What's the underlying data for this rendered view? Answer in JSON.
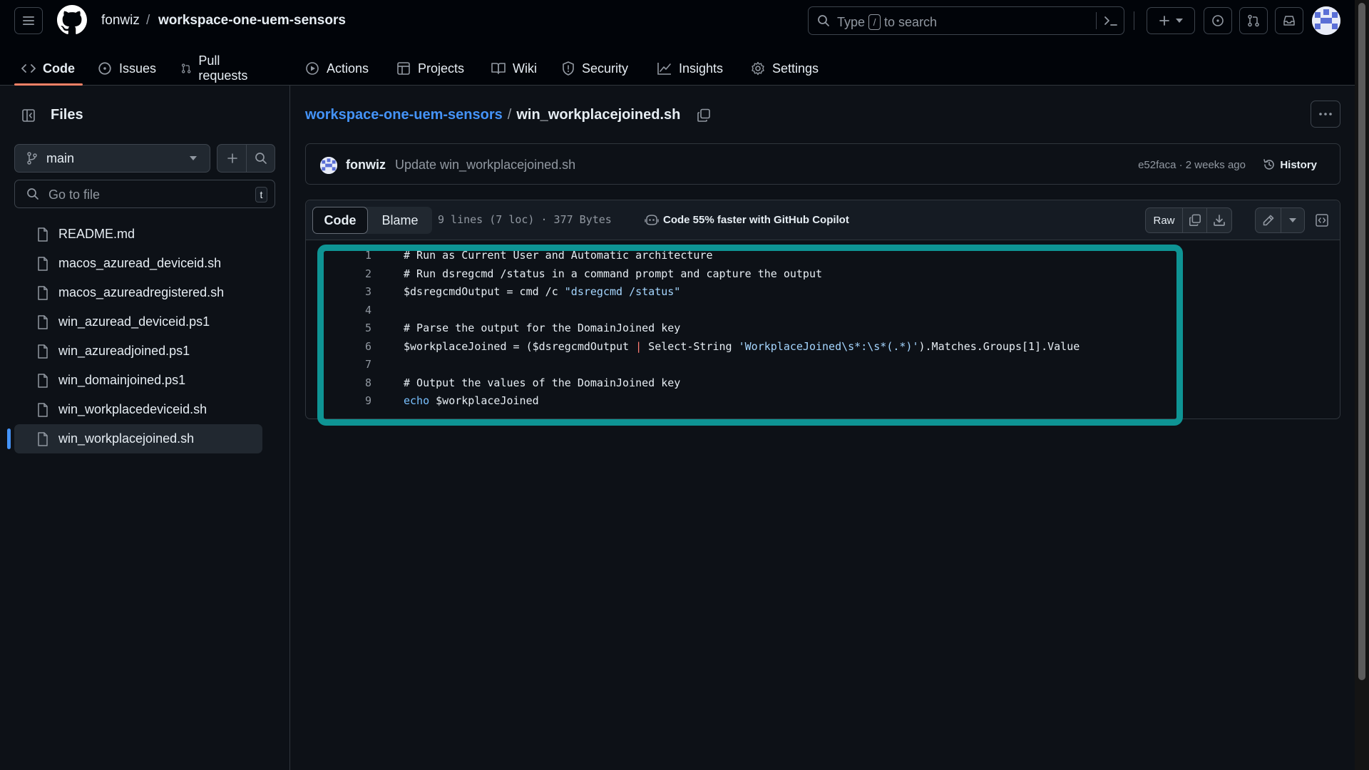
{
  "header": {
    "owner": "fonwiz",
    "separator": "/",
    "repo": "workspace-one-uem-sensors",
    "search": {
      "prefix": "Type",
      "key": "/",
      "suffix": "to search"
    },
    "icons": [
      "menu-icon",
      "github-logo",
      "search-icon",
      "terminal-icon",
      "plus-icon",
      "issues-icon",
      "pull-request-icon",
      "inbox-icon"
    ]
  },
  "nav": {
    "tabs": [
      {
        "label": "Code",
        "icon": "code-icon",
        "active": true
      },
      {
        "label": "Issues",
        "icon": "issues-icon"
      },
      {
        "label": "Pull requests",
        "icon": "pull-request-icon"
      },
      {
        "label": "Actions",
        "icon": "play-icon"
      },
      {
        "label": "Projects",
        "icon": "table-icon"
      },
      {
        "label": "Wiki",
        "icon": "book-icon"
      },
      {
        "label": "Security",
        "icon": "shield-icon"
      },
      {
        "label": "Insights",
        "icon": "graph-icon"
      },
      {
        "label": "Settings",
        "icon": "gear-icon"
      }
    ]
  },
  "sidebar": {
    "title": "Files",
    "branch": "main",
    "goto_placeholder": "Go to file",
    "goto_key": "t",
    "files": [
      {
        "name": "README.md"
      },
      {
        "name": "macos_azuread_deviceid.sh"
      },
      {
        "name": "macos_azureadregistered.sh"
      },
      {
        "name": "win_azuread_deviceid.ps1"
      },
      {
        "name": "win_azureadjoined.ps1"
      },
      {
        "name": "win_domainjoined.ps1"
      },
      {
        "name": "win_workplacedeviceid.sh"
      },
      {
        "name": "win_workplacejoined.sh",
        "selected": true
      }
    ]
  },
  "main": {
    "path": {
      "repo": "workspace-one-uem-sensors",
      "separator": "/",
      "file": "win_workplacejoined.sh"
    },
    "commit": {
      "author": "fonwiz",
      "message": "Update win_workplacejoined.sh",
      "meta": "e52faca · 2 weeks ago",
      "history_label": "History"
    },
    "toolbar": {
      "code_tab": "Code",
      "blame_tab": "Blame",
      "file_info": "9 lines (7 loc) · 377 Bytes",
      "copilot": "Code 55% faster with GitHub Copilot",
      "raw_label": "Raw"
    },
    "code_lines": [
      {
        "n": "1",
        "text": "# Run as Current User and Automatic architecture"
      },
      {
        "n": "2",
        "text": "# Run dsregcmd /status in a command prompt and capture the output"
      },
      {
        "n": "3",
        "text": "$dsregcmdOutput = cmd /c \"dsregcmd /status\""
      },
      {
        "n": "4",
        "text": ""
      },
      {
        "n": "5",
        "text": "# Parse the output for the DomainJoined key"
      },
      {
        "n": "6",
        "text": "$workplaceJoined = ($dsregcmdOutput | Select-String 'WorkplaceJoined\\s*:\\s*(.*)').Matches.Groups[1].Value"
      },
      {
        "n": "7",
        "text": ""
      },
      {
        "n": "8",
        "text": "# Output the values of the DomainJoined key"
      },
      {
        "n": "9",
        "text": "echo $workplaceJoined"
      }
    ]
  },
  "colors": {
    "accent_link": "#4493f8",
    "active_tab_underline": "#f78166",
    "highlight_box": "#0e9494",
    "background": "#0d1117"
  }
}
